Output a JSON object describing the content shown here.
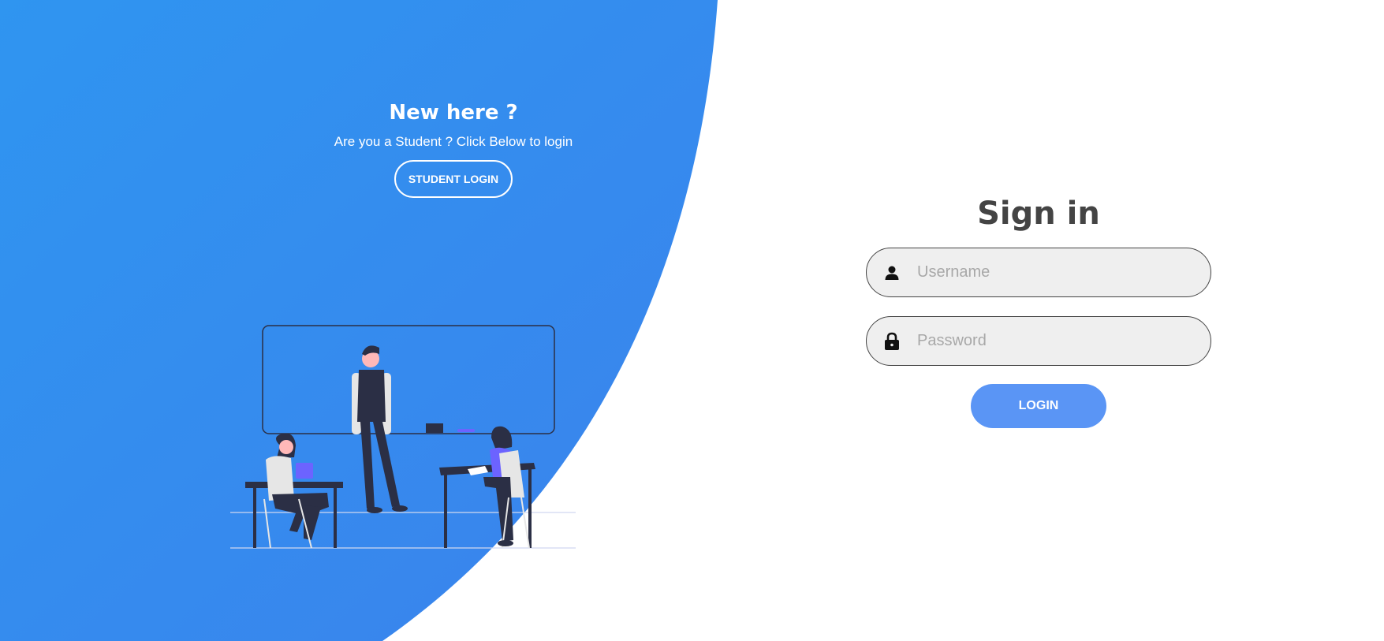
{
  "colors": {
    "blue_start": "#2f95f0",
    "blue_end": "#3b82ec",
    "login_button": "#5a95f5",
    "title_text": "#444444"
  },
  "left_panel": {
    "title": "New here ?",
    "subtitle": "Are you a Student ? Click Below to login",
    "student_button": "STUDENT LOGIN",
    "illustration": "classroom-illustration"
  },
  "signin_form": {
    "title": "Sign in",
    "username": {
      "placeholder": "Username",
      "value": "",
      "icon": "user-icon"
    },
    "password": {
      "placeholder": "Password",
      "value": "",
      "icon": "lock-icon"
    },
    "login_button": "LOGIN"
  }
}
